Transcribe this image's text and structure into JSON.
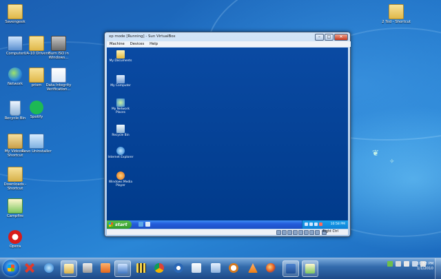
{
  "desktop": {
    "left_icons": [
      {
        "label": "Savengeek",
        "icon": "folder"
      },
      {
        "label": "Computer",
        "icon": "computer"
      },
      {
        "label": "UA-10 Drivers",
        "icon": "folder"
      },
      {
        "label": "Burn ISO in Windows...",
        "icon": "burn"
      },
      {
        "label": "Network",
        "icon": "network"
      },
      {
        "label": "prism",
        "icon": "folder"
      },
      {
        "label": "Data Integrity Verification...",
        "icon": "word"
      },
      {
        "label": "Recycle Bin",
        "icon": "bin"
      },
      {
        "label": "Spotify",
        "icon": "spotify"
      },
      {
        "label": "My Videos - Shortcut",
        "icon": "video"
      },
      {
        "label": "Revo Uninstaller",
        "icon": "revo"
      },
      {
        "label": "Downloads - Shortcut",
        "icon": "down"
      },
      {
        "label": "Campfire",
        "icon": "camp"
      },
      {
        "label": "Opera",
        "icon": "opera"
      }
    ],
    "right_icons": [
      {
        "label": "2 Ted - Shortcut",
        "icon": "folder"
      }
    ]
  },
  "vbox": {
    "title": "xp mode [Running] - Sun VirtualBox",
    "menu": [
      "Machine",
      "Devices",
      "Help"
    ],
    "host_key": "Right Ctrl",
    "guest": {
      "icons": [
        "My Documents",
        "My Computer",
        "My Network Places",
        "Recycle Bin",
        "Internet Explorer",
        "Windows Media Player"
      ],
      "start_label": "start",
      "clock": "10:58 PM"
    }
  },
  "taskbar": {
    "clock_time": "10:58 PM",
    "clock_date": "1/1/2010"
  },
  "colors": {
    "desktop": "#1e73c8",
    "xp_desktop": "#003d8f",
    "xp_start": "#2f9a2b"
  }
}
